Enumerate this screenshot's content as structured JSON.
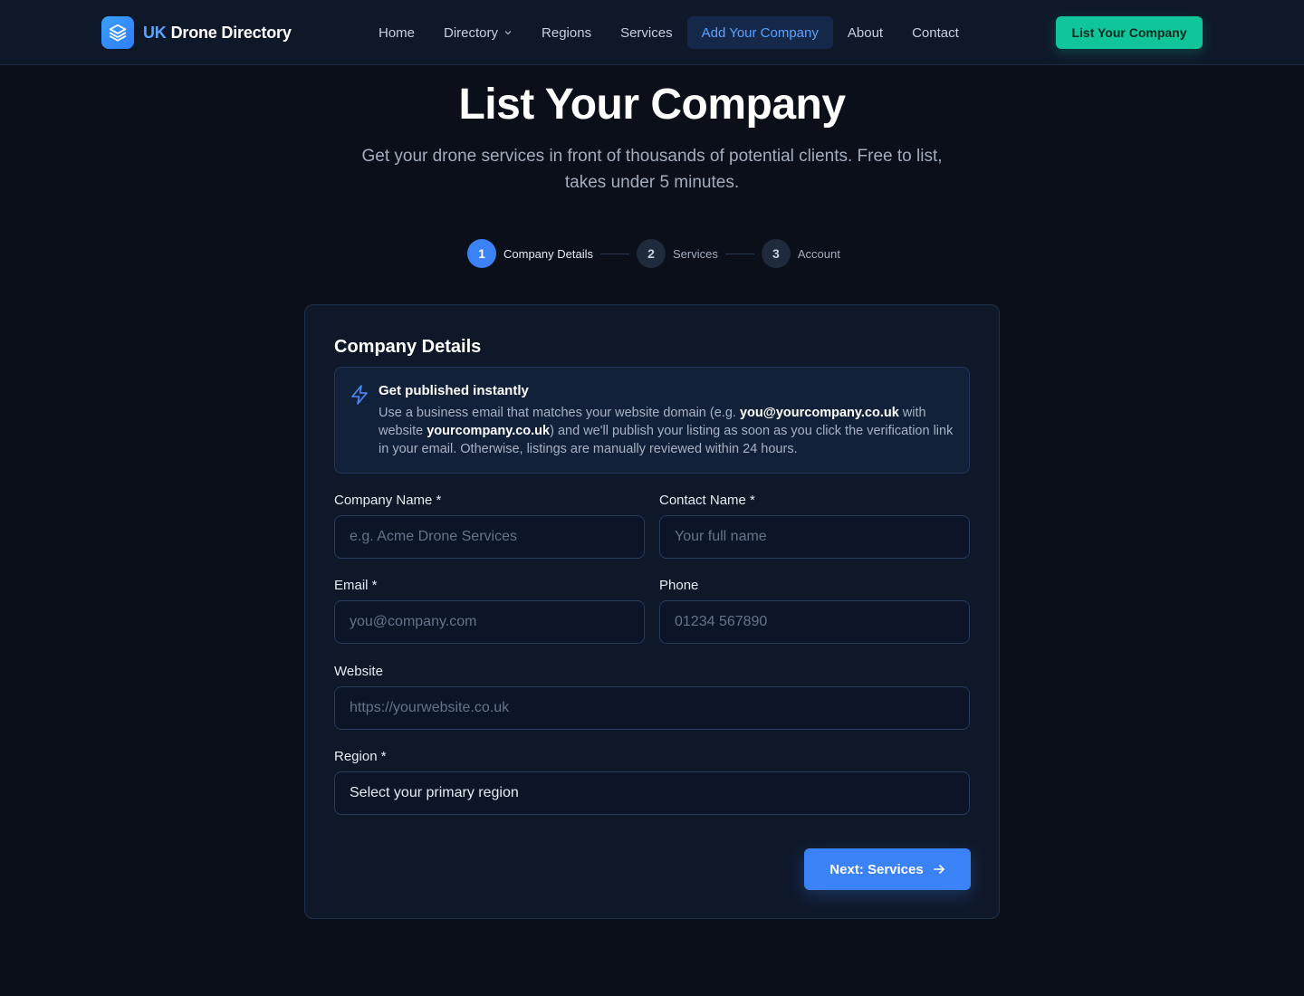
{
  "nav": {
    "brand_prefix": "UK",
    "brand_name": "Drone Directory",
    "links": [
      {
        "label": "Home"
      },
      {
        "label": "Directory"
      },
      {
        "label": "Regions"
      },
      {
        "label": "Services"
      },
      {
        "label": "Add Your Company",
        "active": true
      },
      {
        "label": "About"
      },
      {
        "label": "Contact"
      }
    ],
    "cta_label": "List Your Company",
    "icons": {
      "logo": "layers-icon",
      "dropdown": "chevron-down-icon"
    }
  },
  "hero": {
    "title": "List Your Company",
    "subtitle": "Get your drone services in front of thousands of potential clients. Free to list, takes under 5 minutes."
  },
  "stepper": {
    "steps": [
      {
        "number": "1",
        "label": "Company Details",
        "current": true
      },
      {
        "number": "2",
        "label": "Services"
      },
      {
        "number": "3",
        "label": "Account"
      }
    ]
  },
  "form": {
    "title": "Company Details",
    "notice": {
      "icon": "lightning-icon",
      "title": "Get published instantly",
      "body_1": "Use a business email that matches your website domain (e.g. ",
      "email_example": "you@yourcompany.co.uk",
      "body_2": " with website ",
      "website_example": "yourcompany.co.uk",
      "body_3": ") and we'll publish your listing as soon as you click the verification link in your email. Otherwise, listings are manually reviewed within 24 hours."
    },
    "fields": {
      "company_name": {
        "label": "Company Name *",
        "placeholder": "e.g. Acme Drone Services",
        "value": ""
      },
      "contact_name": {
        "label": "Contact Name *",
        "placeholder": "Your full name",
        "value": ""
      },
      "email": {
        "label": "Email *",
        "placeholder": "you@company.com",
        "value": ""
      },
      "phone": {
        "label": "Phone",
        "placeholder": "01234 567890",
        "value": ""
      },
      "website": {
        "label": "Website",
        "placeholder": "https://yourwebsite.co.uk",
        "value": ""
      },
      "region": {
        "label": "Region *",
        "selected": "Select your primary region"
      }
    },
    "next_label": "Next: Services",
    "next_icon": "arrow-right-icon"
  },
  "colors": {
    "background": "#0a0f1a",
    "card": "#0f1829",
    "accent_blue": "#3b82f6",
    "accent_green": "#10c59a"
  }
}
